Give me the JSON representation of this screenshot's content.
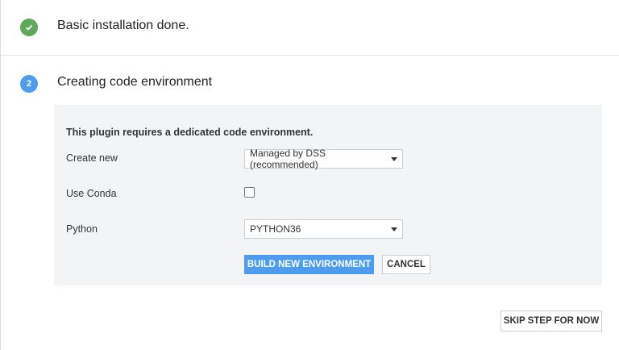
{
  "steps": [
    {
      "status": "done",
      "icon": "check-icon",
      "title": "Basic installation done."
    },
    {
      "status": "active",
      "number": "2",
      "title": "Creating code environment"
    }
  ],
  "form": {
    "heading": "This plugin requires a dedicated code environment.",
    "create_new_label": "Create new",
    "create_new_value": "Managed by DSS (recommended)",
    "use_conda_label": "Use Conda",
    "use_conda_checked": false,
    "python_label": "Python",
    "python_value": "PYTHON36",
    "build_label": "BUILD NEW ENVIRONMENT",
    "cancel_label": "CANCEL"
  },
  "skip_label": "SKIP STEP FOR NOW",
  "colors": {
    "done": "#5fa85a",
    "active": "#4e9cf0",
    "primary": "#4e9cf0"
  }
}
